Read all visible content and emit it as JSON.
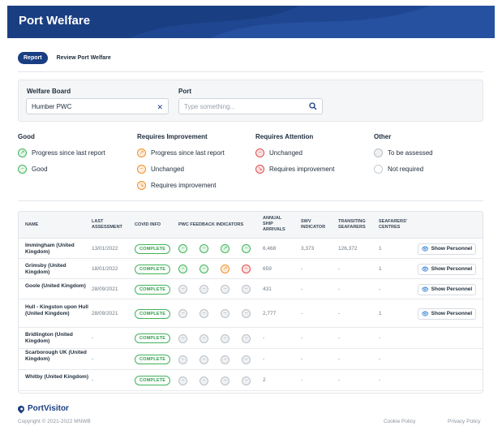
{
  "header": {
    "title": "Port Welfare"
  },
  "tabs": [
    {
      "label": "Report",
      "active": true
    },
    {
      "label": "Review Port Welfare",
      "active": false
    }
  ],
  "filters": {
    "welfare_board_label": "Welfare Board",
    "welfare_board_value": "Humber PWC",
    "port_label": "Port",
    "port_placeholder": "Type something..."
  },
  "legend": {
    "good": {
      "title": "Good",
      "items": [
        {
          "label": "Progress since last report",
          "status": "good-progress"
        },
        {
          "label": "Good",
          "status": "good"
        }
      ]
    },
    "improve": {
      "title": "Requires Improvement",
      "items": [
        {
          "label": "Progress since last report",
          "status": "improve-progress"
        },
        {
          "label": "Unchanged",
          "status": "improve-unchanged"
        },
        {
          "label": "Requires improvement",
          "status": "improve-required"
        }
      ]
    },
    "attention": {
      "title": "Requires Attention",
      "items": [
        {
          "label": "Unchanged",
          "status": "attention-unchanged"
        },
        {
          "label": "Requires improvement",
          "status": "attention-required"
        }
      ]
    },
    "other": {
      "title": "Other",
      "items": [
        {
          "label": "To be assessed",
          "status": "other-assess"
        },
        {
          "label": "Not required",
          "status": "other-not-required"
        }
      ]
    }
  },
  "table": {
    "headers": {
      "name": "Name",
      "last_assessment": "Last Assessment",
      "covid": "Covid Info",
      "pwc": "PWC Feedback Indicators",
      "arrivals": "Annual Ship Arrivals",
      "swv": "SWV Indicator",
      "transiting": "Transiting Seafarers",
      "centres": "Seafarers' Centres"
    },
    "show_personnel_label": "Show Personnel",
    "rows": [
      {
        "name": "Immingham (United Kingdom)",
        "last": "13/01/2022",
        "covid": "COMPLETE",
        "ind": [
          "good",
          "good",
          "good-progress",
          "good"
        ],
        "arrivals": "6,468",
        "swv": "3,373",
        "transiting": "126,372",
        "centres": "1",
        "btn": true
      },
      {
        "name": "Grimsby (United Kingdom)",
        "last": "18/01/2022",
        "covid": "COMPLETE",
        "ind": [
          "good",
          "good",
          "improve-progress",
          "attention-unchanged"
        ],
        "arrivals": "659",
        "swv": "-",
        "transiting": "-",
        "centres": "1",
        "btn": true
      },
      {
        "name": "Goole (United Kingdom)",
        "last": "28/09/2021",
        "covid": "COMPLETE",
        "ind": [
          "other-assess",
          "other-assess",
          "other-assess",
          "other-assess"
        ],
        "arrivals": "431",
        "swv": "-",
        "transiting": "-",
        "centres": "-",
        "btn": true
      },
      {
        "name": "Hull - Kingston upon Hull (United Kingdom)",
        "last": "28/09/2021",
        "covid": "COMPLETE",
        "ind": [
          "other-assess",
          "other-assess",
          "other-assess",
          "other-assess"
        ],
        "arrivals": "2,777",
        "swv": "-",
        "transiting": "-",
        "centres": "1",
        "btn": true
      },
      {
        "name": "Bridlington (United Kingdom)",
        "last": "-",
        "covid": "COMPLETE",
        "ind": [
          "other-assess",
          "other-assess",
          "other-assess",
          "other-assess"
        ],
        "arrivals": "-",
        "swv": "-",
        "transiting": "-",
        "centres": "-",
        "btn": false
      },
      {
        "name": "Scarborough UK (United Kingdom)",
        "last": "-",
        "covid": "COMPLETE",
        "ind": [
          "other-assess",
          "other-assess",
          "other-assess",
          "other-assess"
        ],
        "arrivals": "-",
        "swv": "-",
        "transiting": "-",
        "centres": "-",
        "btn": false
      },
      {
        "name": "Whitby (United Kingdom)",
        "last": "-",
        "covid": "COMPLETE",
        "ind": [
          "other-assess",
          "other-assess",
          "other-assess",
          "other-assess"
        ],
        "arrivals": "2",
        "swv": "-",
        "transiting": "-",
        "centres": "-",
        "btn": false
      }
    ]
  },
  "footer": {
    "brand": "PortVisitor",
    "copyright": "Copyright © 2021-2022 MNWB",
    "cookie": "Cookie Policy",
    "privacy": "Privacy Policy"
  },
  "colors": {
    "brand": "#1a3e82",
    "good": "#3fb45a",
    "improve": "#f0902a",
    "attention": "#e24d4d",
    "neutral": "#b9c0c7"
  }
}
